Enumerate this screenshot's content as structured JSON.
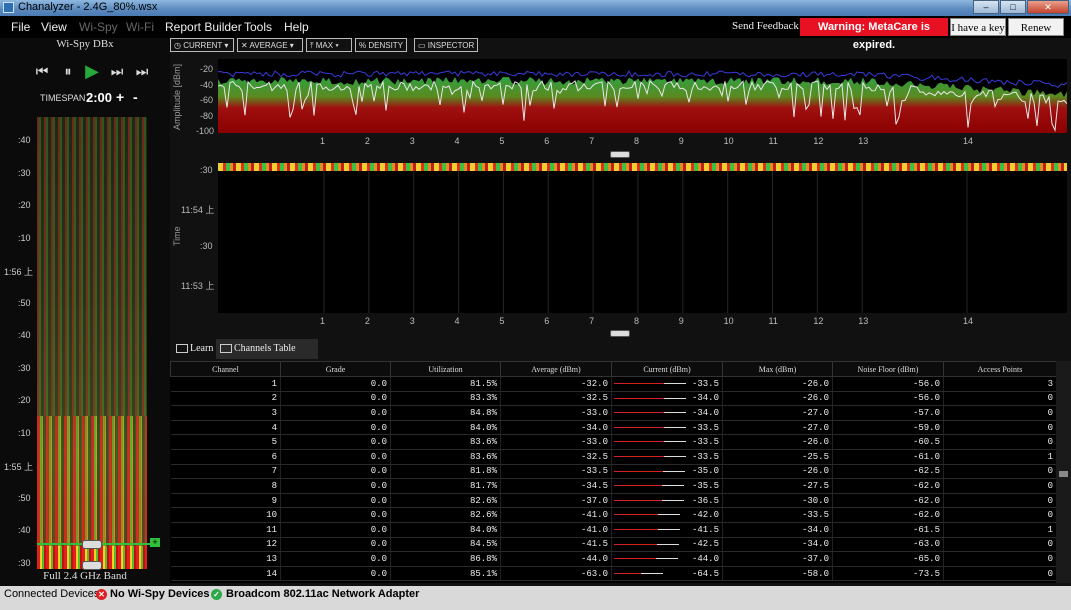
{
  "window": {
    "title": "Chanalyzer - 2.4G_80%.wsx",
    "min": "–",
    "max": "□",
    "close": "✕"
  },
  "menu": {
    "items": [
      "File",
      "View",
      "Wi-Spy",
      "Wi-Fi",
      "Report Builder",
      "Tools",
      "Help"
    ],
    "send_feedback": "Send Feedback",
    "warning": "Warning: MetaCare is expired.",
    "have_key": "I have a key",
    "renew": "Renew"
  },
  "device": {
    "name": "Wi-Spy DBx",
    "band": "Full 2.4 GHz Band"
  },
  "transport": {
    "first": "⏮",
    "pause": "⏸",
    "play": "▶",
    "next": "⏭",
    "last": "⏭"
  },
  "timespan": {
    "label": "TIMESPAN",
    "value": "2:00",
    "plus": "+",
    "minus": "-"
  },
  "waterfall_ticks": [
    ":40",
    ":30",
    ":20",
    ":10",
    "1:56 上",
    ":50",
    ":40",
    ":30",
    ":20",
    ":10",
    "1:55 上",
    ":50",
    ":40",
    ":30"
  ],
  "toolbar": {
    "current": "CURRENT",
    "average": "AVERAGE",
    "max": "MAX",
    "density": "DENSITY",
    "inspector": "INSPECTOR",
    "current_icon": "clock-icon",
    "average_icon": "average-icon",
    "max_icon": "max-icon",
    "density_icon": "percent-icon",
    "inspector_icon": "inspector-icon"
  },
  "amplitude": {
    "ylabel": "Amplitude [dBm]",
    "yticks": [
      "-20",
      "-40",
      "-60",
      "-80",
      "-100"
    ]
  },
  "timeline": {
    "ylabel": "Time",
    "yticks": [
      ":30",
      "11:54 上",
      ":30",
      "11:53 上"
    ]
  },
  "channel_axis": [
    "1",
    "2",
    "3",
    "4",
    "5",
    "6",
    "7",
    "8",
    "9",
    "10",
    "11",
    "12",
    "13",
    "14"
  ],
  "tabs": {
    "learn": "Learn",
    "channels_table": "Channels Table"
  },
  "table": {
    "headers": [
      "Channel",
      "Grade",
      "Utilization",
      "Average (dBm)",
      "Current (dBm)",
      "Max (dBm)",
      "Noise Floor (dBm)",
      "Access Points"
    ],
    "rows": [
      [
        "1",
        "0.0",
        "81.5%",
        "-32.0",
        "-33.5",
        "-26.0",
        "-56.0",
        "3"
      ],
      [
        "2",
        "0.0",
        "83.3%",
        "-32.5",
        "-34.0",
        "-26.0",
        "-56.0",
        "0"
      ],
      [
        "3",
        "0.0",
        "84.8%",
        "-33.0",
        "-34.0",
        "-27.0",
        "-57.0",
        "0"
      ],
      [
        "4",
        "0.0",
        "84.0%",
        "-34.0",
        "-33.5",
        "-27.0",
        "-59.0",
        "0"
      ],
      [
        "5",
        "0.0",
        "83.6%",
        "-33.0",
        "-33.5",
        "-26.0",
        "-60.5",
        "0"
      ],
      [
        "6",
        "0.0",
        "83.6%",
        "-32.5",
        "-33.5",
        "-25.5",
        "-61.0",
        "1"
      ],
      [
        "7",
        "0.0",
        "81.8%",
        "-33.5",
        "-35.0",
        "-26.0",
        "-62.5",
        "0"
      ],
      [
        "8",
        "0.0",
        "81.7%",
        "-34.5",
        "-35.5",
        "-27.5",
        "-62.0",
        "0"
      ],
      [
        "9",
        "0.0",
        "82.6%",
        "-37.0",
        "-36.5",
        "-30.0",
        "-62.0",
        "0"
      ],
      [
        "10",
        "0.0",
        "82.6%",
        "-41.0",
        "-42.0",
        "-33.5",
        "-62.0",
        "0"
      ],
      [
        "11",
        "0.0",
        "84.0%",
        "-41.0",
        "-41.5",
        "-34.0",
        "-61.5",
        "1"
      ],
      [
        "12",
        "0.0",
        "84.5%",
        "-41.5",
        "-42.5",
        "-34.0",
        "-63.0",
        "0"
      ],
      [
        "13",
        "0.0",
        "86.8%",
        "-44.0",
        "-44.0",
        "-37.0",
        "-65.0",
        "0"
      ],
      [
        "14",
        "0.0",
        "85.1%",
        "-63.0",
        "-64.5",
        "-58.0",
        "-73.5",
        "0"
      ]
    ]
  },
  "status": {
    "label": "Connected Devices:",
    "device1": "No Wi-Spy Devices",
    "device2": "Broadcom 802.11ac Network Adapter",
    "device1_color": "#e02020",
    "device2_color": "#2fa84a"
  }
}
